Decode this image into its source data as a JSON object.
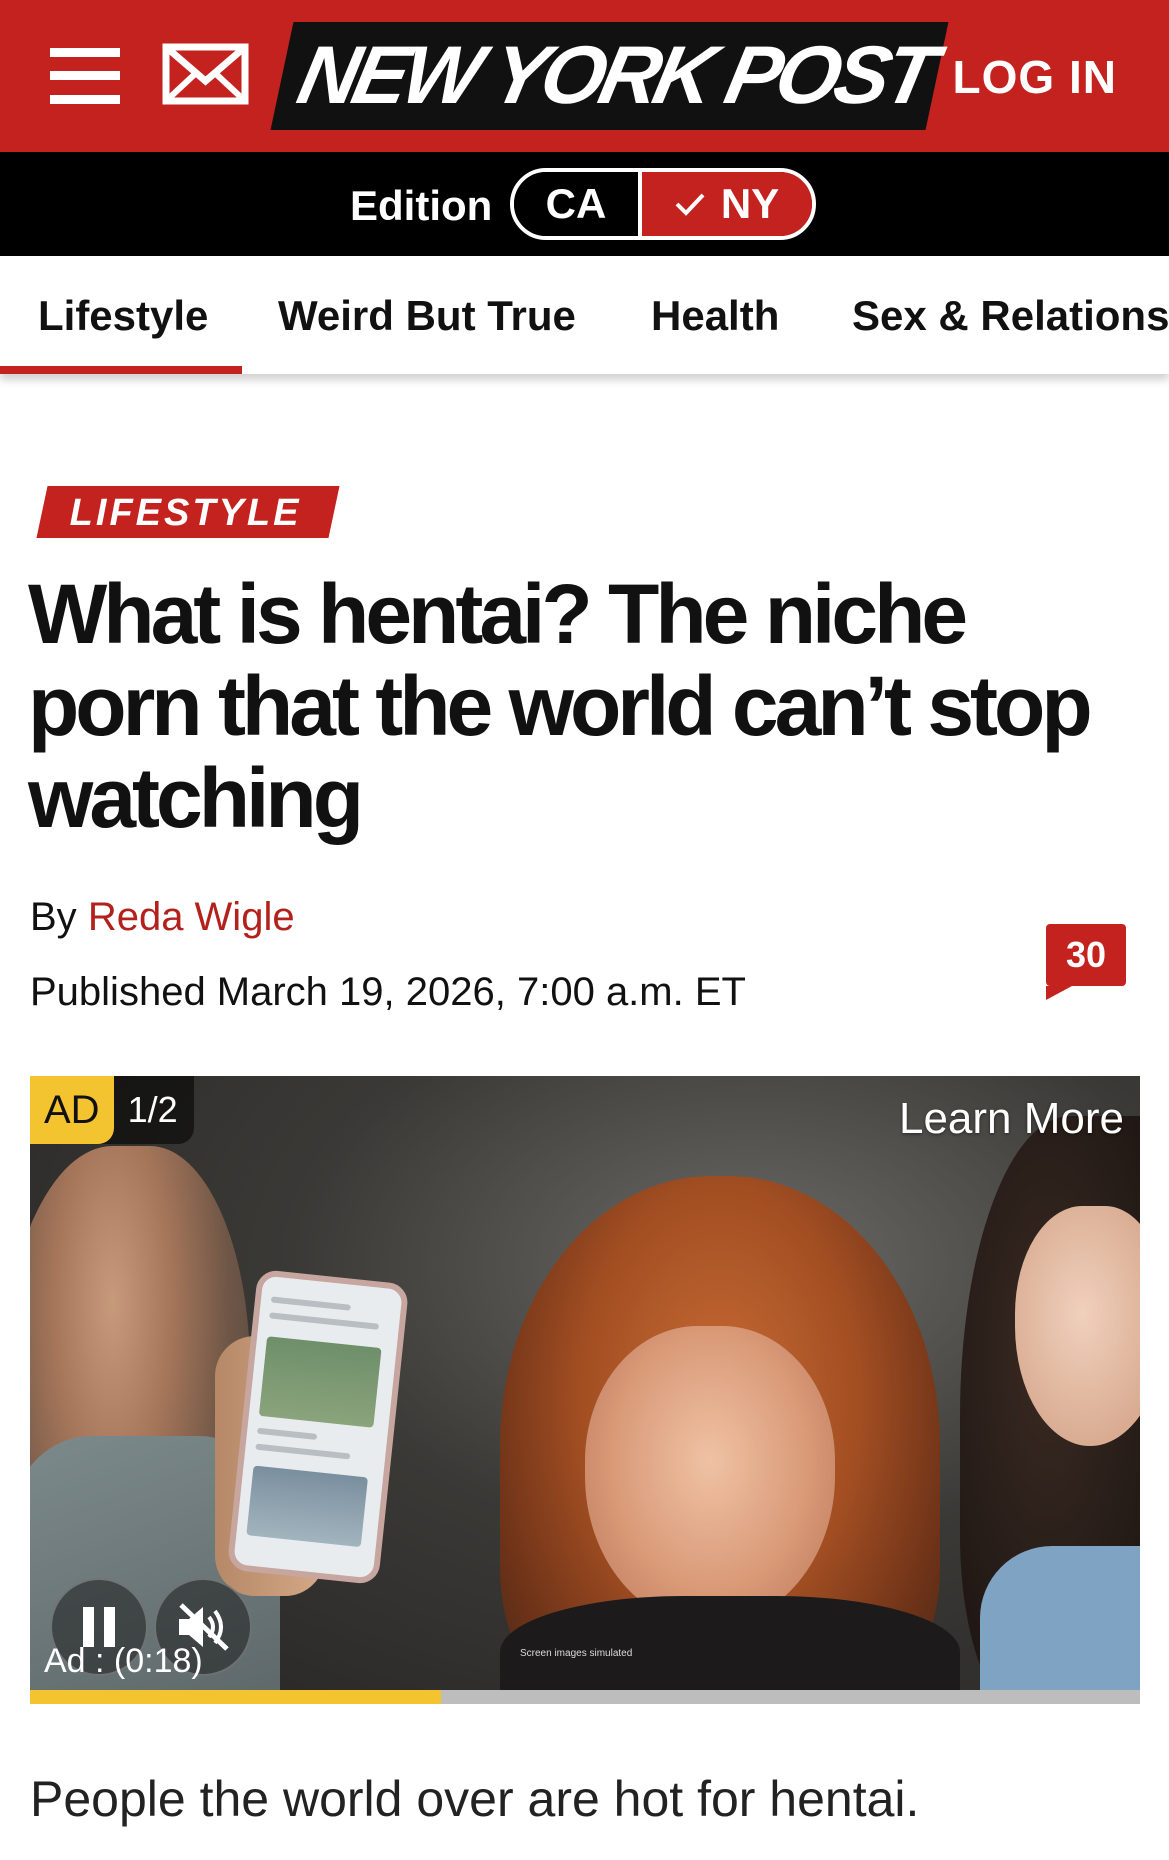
{
  "header": {
    "logo_text": "NEW YORK POST",
    "login_label": "LOG IN",
    "menu_icon": "hamburger-menu-icon",
    "mail_icon": "envelope-icon",
    "brand_color": "#c4221e"
  },
  "edition": {
    "label": "Edition",
    "options": [
      "CA",
      "NY"
    ],
    "selected": "NY"
  },
  "nav": {
    "items": [
      "Lifestyle",
      "Weird But True",
      "Health",
      "Sex & Relationships"
    ],
    "active": "Lifestyle"
  },
  "article": {
    "category": "LIFESTYLE",
    "headline": "What is hentai? The niche porn that the world can’t stop watching",
    "byline_prefix": "By",
    "author": "Reda Wigle",
    "published": "Published March 19, 2026, 7:00 a.m. ET",
    "comment_count": "30",
    "first_paragraph": "People the world over are hot for hentai."
  },
  "video_ad": {
    "badge": "AD",
    "ad_index": "1/2",
    "learn_more": "Learn More",
    "ad_time": "Ad : (0:18)",
    "screen_note": "Screen images simulated",
    "progress_fraction": 0.37,
    "pause_icon": "pause-icon",
    "mute_icon": "muted-speaker-icon"
  }
}
